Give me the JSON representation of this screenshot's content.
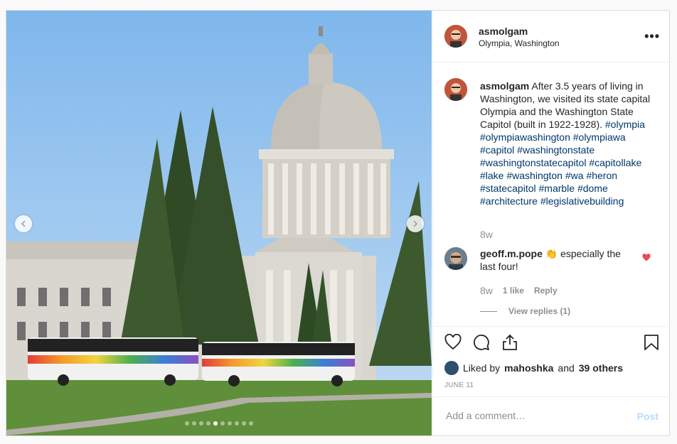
{
  "post": {
    "username": "asmolgam",
    "location": "Olympia, Washington",
    "more_icon": "more-options-icon",
    "carousel": {
      "total_slides": 10,
      "active_index": 4
    },
    "caption": {
      "username": "asmolgam",
      "text": "After 3.5 years of living in Washington, we visited its state capital Olympia and the Washington State Capitol (built in 1922-1928).",
      "hashtags": [
        "#olympia",
        "#olympiawashington",
        "#olympiawa",
        "#capitol",
        "#washingtonstate",
        "#washingtonstatecapitol",
        "#capitollake",
        "#lake",
        "#washington",
        "#wa",
        "#heron",
        "#statecapitol",
        "#marble",
        "#dome",
        "#architecture",
        "#legislativebuilding"
      ],
      "time": "8w"
    },
    "comment": {
      "username": "geoff.m.pope",
      "text": "👏 especially the last four!",
      "time": "8w",
      "likes": "1 like",
      "reply_label": "Reply",
      "view_replies": "View replies (1)",
      "liked": true
    },
    "liked_by": {
      "prefix": "Liked by",
      "user": "mahoshka",
      "middle": "and",
      "others": "39 others"
    },
    "date": "JUNE 11",
    "add_comment_placeholder": "Add a comment…",
    "post_label": "Post",
    "colors": {
      "hashtag": "#00376b",
      "heart": "#ed4956",
      "post_disabled": "#b3dbff",
      "muted": "#8e8e8e"
    }
  }
}
